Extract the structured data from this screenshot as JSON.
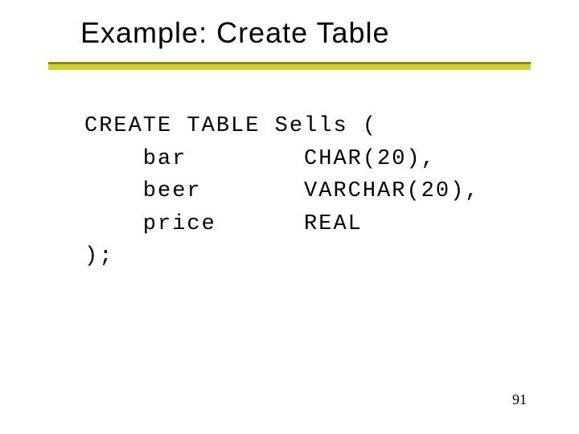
{
  "title": "Example: Create Table",
  "code": "CREATE TABLE Sells (\n    bar        CHAR(20),\n    beer       VARCHAR(20),\n    price      REAL\n);",
  "pageNumber": "91"
}
